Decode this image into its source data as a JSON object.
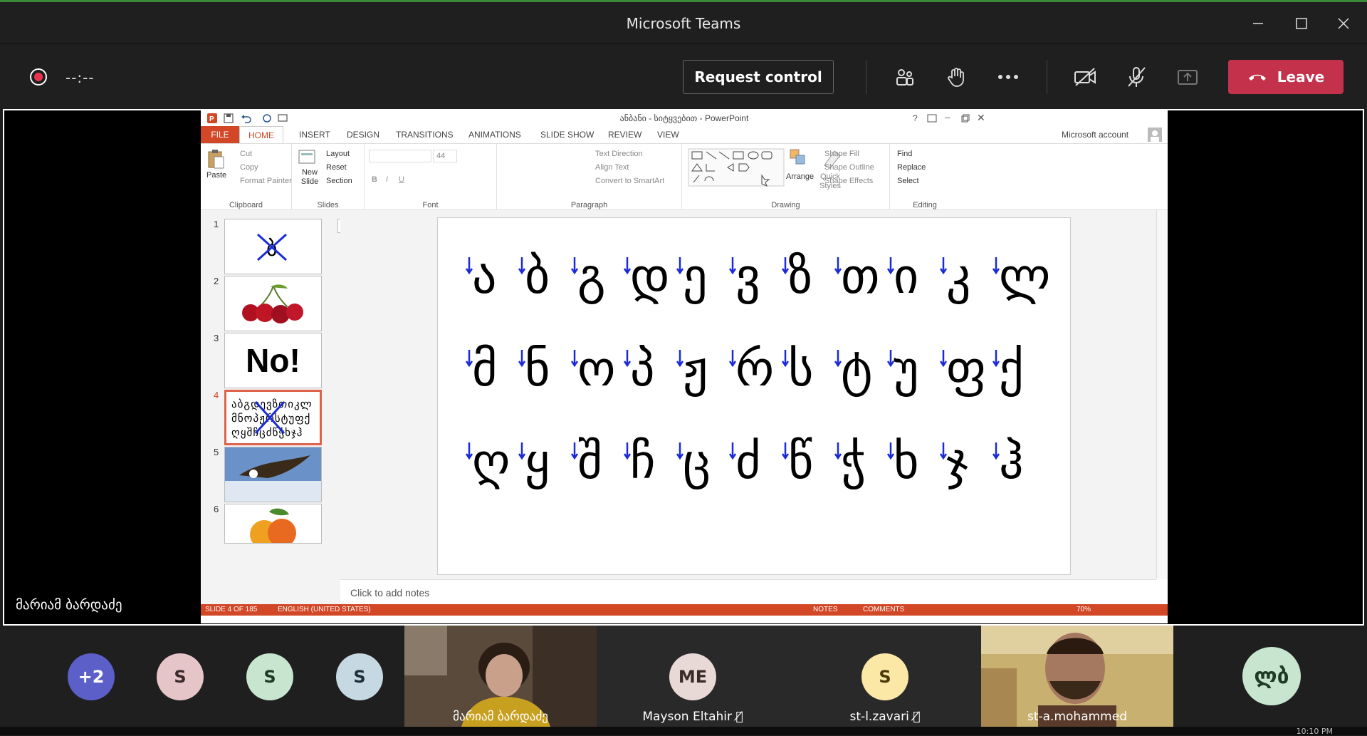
{
  "window": {
    "title": "Microsoft Teams"
  },
  "toolbar": {
    "timer": "--:--",
    "request_control": "Request control",
    "leave": "Leave"
  },
  "presenter_name": "მარიამ ბარდაძე",
  "ppt": {
    "title": "ანბანი - სიტყვებით - PowerPoint",
    "account": "Microsoft account",
    "tabs": [
      "FILE",
      "HOME",
      "INSERT",
      "DESIGN",
      "TRANSITIONS",
      "ANIMATIONS",
      "SLIDE SHOW",
      "REVIEW",
      "VIEW"
    ],
    "clipboard": {
      "paste": "Paste",
      "cut": "Cut",
      "copy": "Copy",
      "format_painter": "Format Painter",
      "label": "Clipboard"
    },
    "slides_grp": {
      "new_slide": "New Slide",
      "layout": "Layout",
      "reset": "Reset",
      "section": "Section",
      "label": "Slides"
    },
    "font_grp": {
      "size": "44",
      "label": "Font"
    },
    "paragraph_grp": {
      "text_direction": "Text Direction",
      "align_text": "Align Text",
      "convert": "Convert to SmartArt",
      "label": "Paragraph"
    },
    "drawing_grp": {
      "arrange": "Arrange",
      "quick_styles": "Quick Styles",
      "shape_fill": "Shape Fill",
      "shape_outline": "Shape Outline",
      "shape_effects": "Shape Effects",
      "label": "Drawing"
    },
    "editing_grp": {
      "find": "Find",
      "replace": "Replace",
      "select": "Select",
      "label": "Editing"
    },
    "thumb_nums": [
      "1",
      "2",
      "3",
      "4",
      "5",
      "6"
    ],
    "thumb3_text": "No!",
    "notes_placeholder": "Click to add notes",
    "status": {
      "slide": "SLIDE 4 OF 185",
      "language": "ENGLISH (UNITED STATES)",
      "notes": "NOTES",
      "comments": "COMMENTS",
      "zoom": "70%"
    },
    "slide_rows": [
      [
        "ა",
        "ბ",
        "გ",
        "დ",
        "ე",
        "ვ",
        "ზ",
        "თ",
        "ი",
        "კ",
        "ლ"
      ],
      [
        "მ",
        "ნ",
        "ო",
        "პ",
        "ჟ",
        "რ",
        "ს",
        "ტ",
        "უ",
        "ფ",
        "ქ"
      ],
      [
        "ღ",
        "ყ",
        "შ",
        "ჩ",
        "ც",
        "ძ",
        "წ",
        "ჭ",
        "ხ",
        "ჯ",
        "ჰ"
      ]
    ]
  },
  "participants": {
    "more": "+2",
    "initial_s": "S",
    "tile1_name": "მარიამ ბარდაძე",
    "tile2_initials": "ME",
    "tile2_name": "Mayson Eltahir",
    "tile3_name": "st-l.zavari",
    "tile4_name": "st-a.mohammed",
    "last_initials": "ლბ"
  },
  "clock": "10:10 PM"
}
